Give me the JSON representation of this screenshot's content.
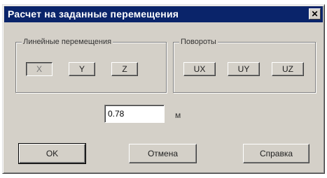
{
  "window": {
    "title": "Расчет на заданные перемещения",
    "close_glyph": "✕"
  },
  "linear_group": {
    "label": "Линейные перемещения",
    "buttons": [
      "X",
      "Y",
      "Z"
    ]
  },
  "rotation_group": {
    "label": "Повороты",
    "buttons": [
      "UX",
      "UY",
      "UZ"
    ]
  },
  "displacement": {
    "value": "0.78",
    "unit": "м"
  },
  "actions": {
    "ok": "OK",
    "cancel": "Отмена",
    "help": "Справка"
  }
}
